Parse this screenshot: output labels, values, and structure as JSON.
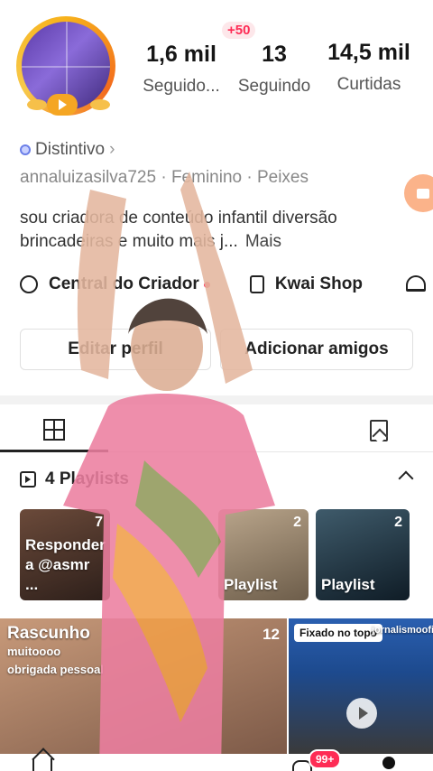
{
  "profile": {
    "plus_badge": "+50",
    "stats": [
      {
        "value": "1,6 mil",
        "label": "Seguido..."
      },
      {
        "value": "13",
        "label": "Seguindo"
      },
      {
        "value": "14,5 mil",
        "label": "Curtidas"
      }
    ],
    "badge_label": "Distintivo",
    "meta": "annaluizasilva725 · Feminino · Peixes",
    "bio": "sou criadora de conteúdo infantil diversão brincadeiras e muito mais j...",
    "bio_more": "Mais"
  },
  "links": {
    "creator_center": "Central do Criador",
    "kwai_shop": "Kwai Shop"
  },
  "buttons": {
    "edit_profile": "Editar perfil",
    "add_friends": "Adicionar amigos"
  },
  "playlists": {
    "header": "4 Playlists",
    "items": [
      {
        "title": "Responder a @asmr ...",
        "count": "7"
      },
      {
        "title": "Playlist",
        "count": "2"
      },
      {
        "title": "Playlist",
        "count": "2"
      }
    ]
  },
  "videos": [
    {
      "title": "Rascunho",
      "subtitle": "muitoooo obrigada pessoal",
      "count": "12"
    },
    {
      "pinned_label": "Fixado no topo",
      "channel": "jornalismooficial"
    }
  ],
  "nav": {
    "notification_count": "99+"
  },
  "colors": {
    "accent": "#fe2c55",
    "avatar_ring": "#f7b21c",
    "badge_icon": "#6b7fe8"
  }
}
